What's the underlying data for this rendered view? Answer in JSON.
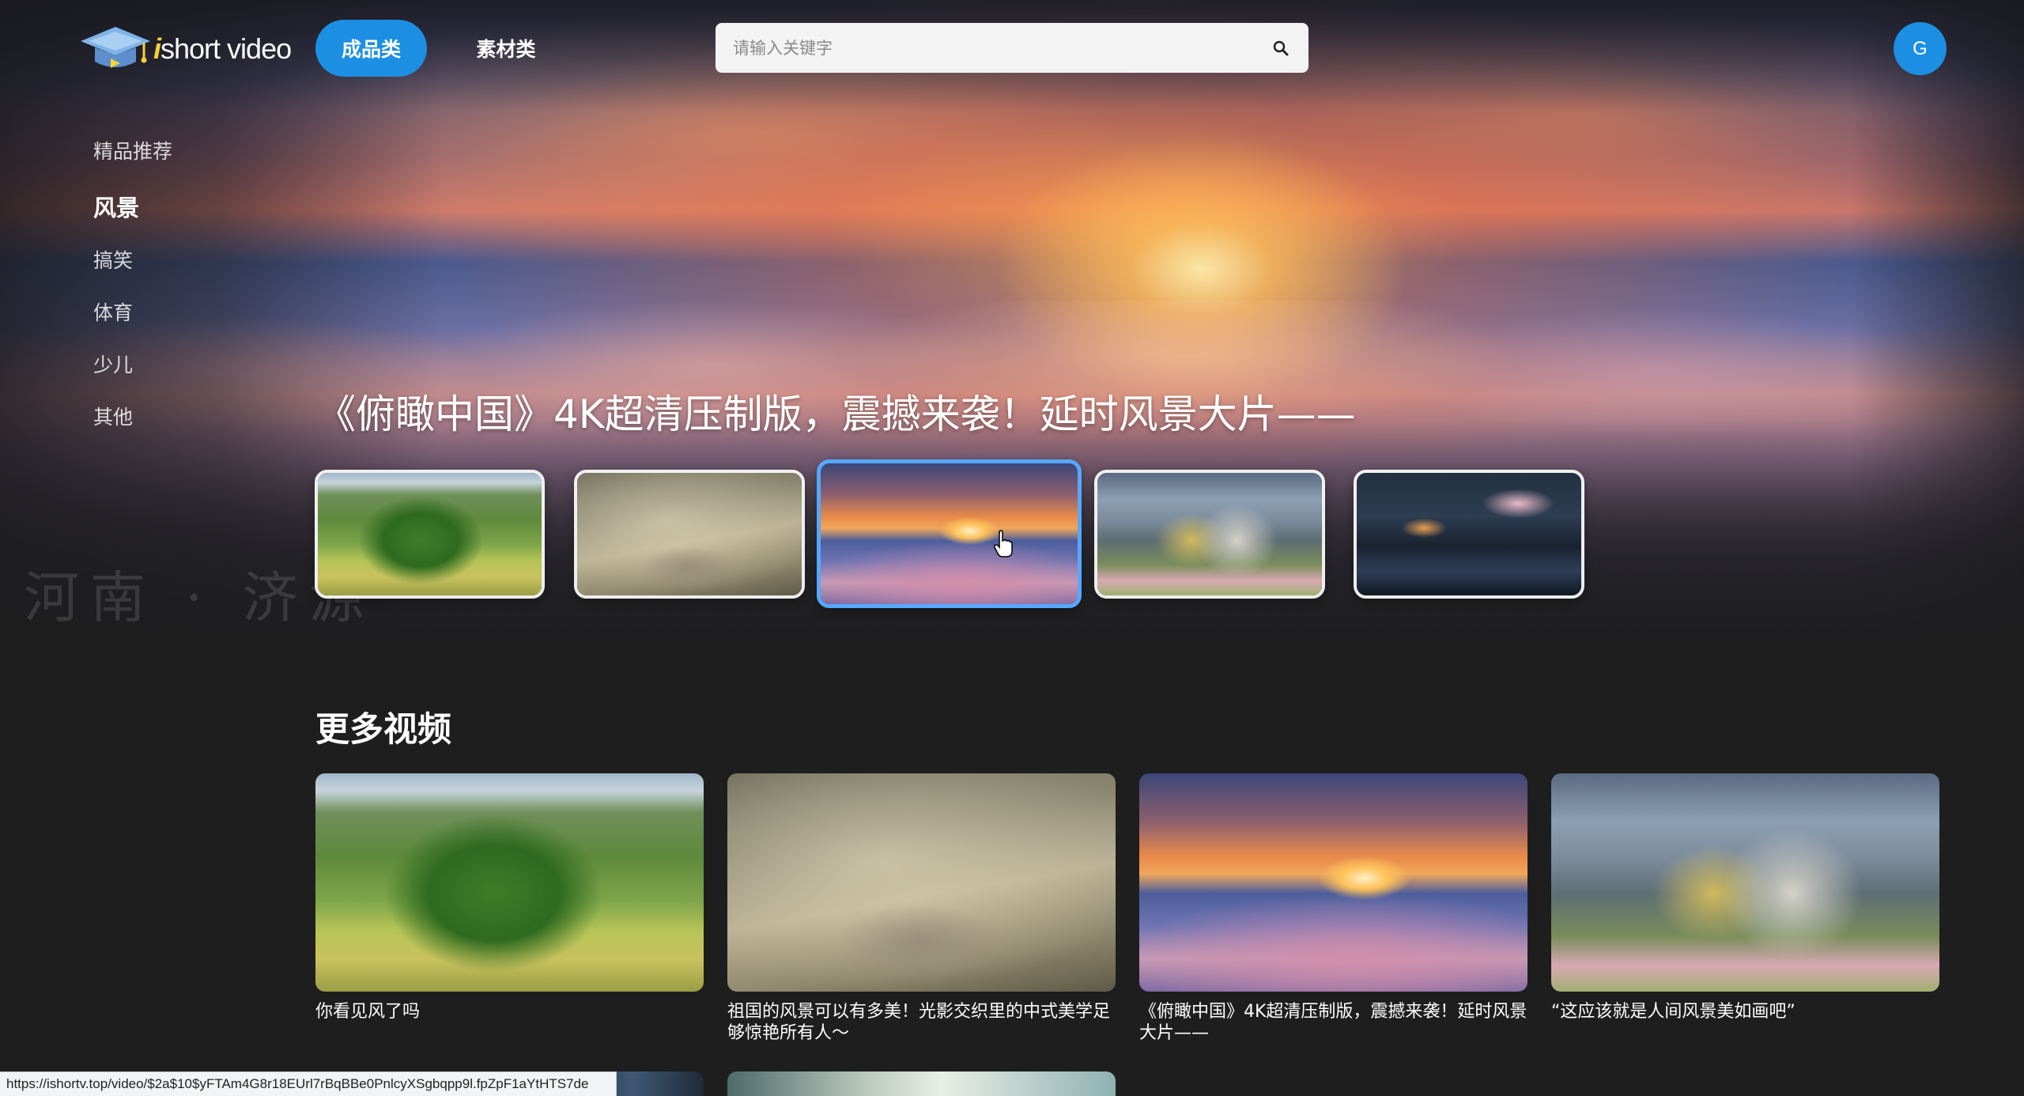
{
  "brand": {
    "logo_prefix": "i",
    "logo_suffix": "short video"
  },
  "nav": {
    "tabs": [
      {
        "label": "成品类",
        "active": true
      },
      {
        "label": "素材类",
        "active": false
      }
    ]
  },
  "search": {
    "placeholder": "请输入关键字",
    "value": ""
  },
  "user": {
    "avatar_initial": "G"
  },
  "sidebar": {
    "items": [
      {
        "label": "精品推荐",
        "active": false
      },
      {
        "label": "风景",
        "active": true
      },
      {
        "label": "搞笑",
        "active": false
      },
      {
        "label": "体育",
        "active": false
      },
      {
        "label": "少儿",
        "active": false
      },
      {
        "label": "其他",
        "active": false
      }
    ]
  },
  "hero": {
    "title": "《俯瞰中国》4K超清压制版，震撼来袭！延时风景大片——",
    "watermark": "河南 · 济源",
    "selected_index": 2,
    "thumbnails": [
      {
        "icon": "tree-meadow-thumbnail"
      },
      {
        "icon": "misty-temple-thumbnail"
      },
      {
        "icon": "sunset-clouds-thumbnail"
      },
      {
        "icon": "girl-painting-thumbnail"
      },
      {
        "icon": "night-town-thumbnail"
      }
    ]
  },
  "more_videos": {
    "title": "更多视频",
    "cards": [
      {
        "caption": "你看见风了吗",
        "icon": "tree-meadow-image"
      },
      {
        "caption": "祖国的风景可以有多美！光影交织里的中式美学足够惊艳所有人～",
        "icon": "misty-temple-image"
      },
      {
        "caption": "《俯瞰中国》4K超清压制版，震撼来袭！延时风景大片——",
        "icon": "sunset-clouds-image"
      },
      {
        "caption": "“这应该就是人间风景美如画吧”",
        "icon": "girl-painting-image"
      }
    ]
  },
  "status_bar": {
    "url": "https://ishortv.top/video/$2a$10$yFTAm4G8r18EUrl7rBqBBe0PnlcyXSgbqpp9l.fpZpF1aYtHTS7de"
  },
  "colors": {
    "accent": "#1c8fe3",
    "background": "#1e1e1f",
    "selected_border": "#56a8ff"
  }
}
